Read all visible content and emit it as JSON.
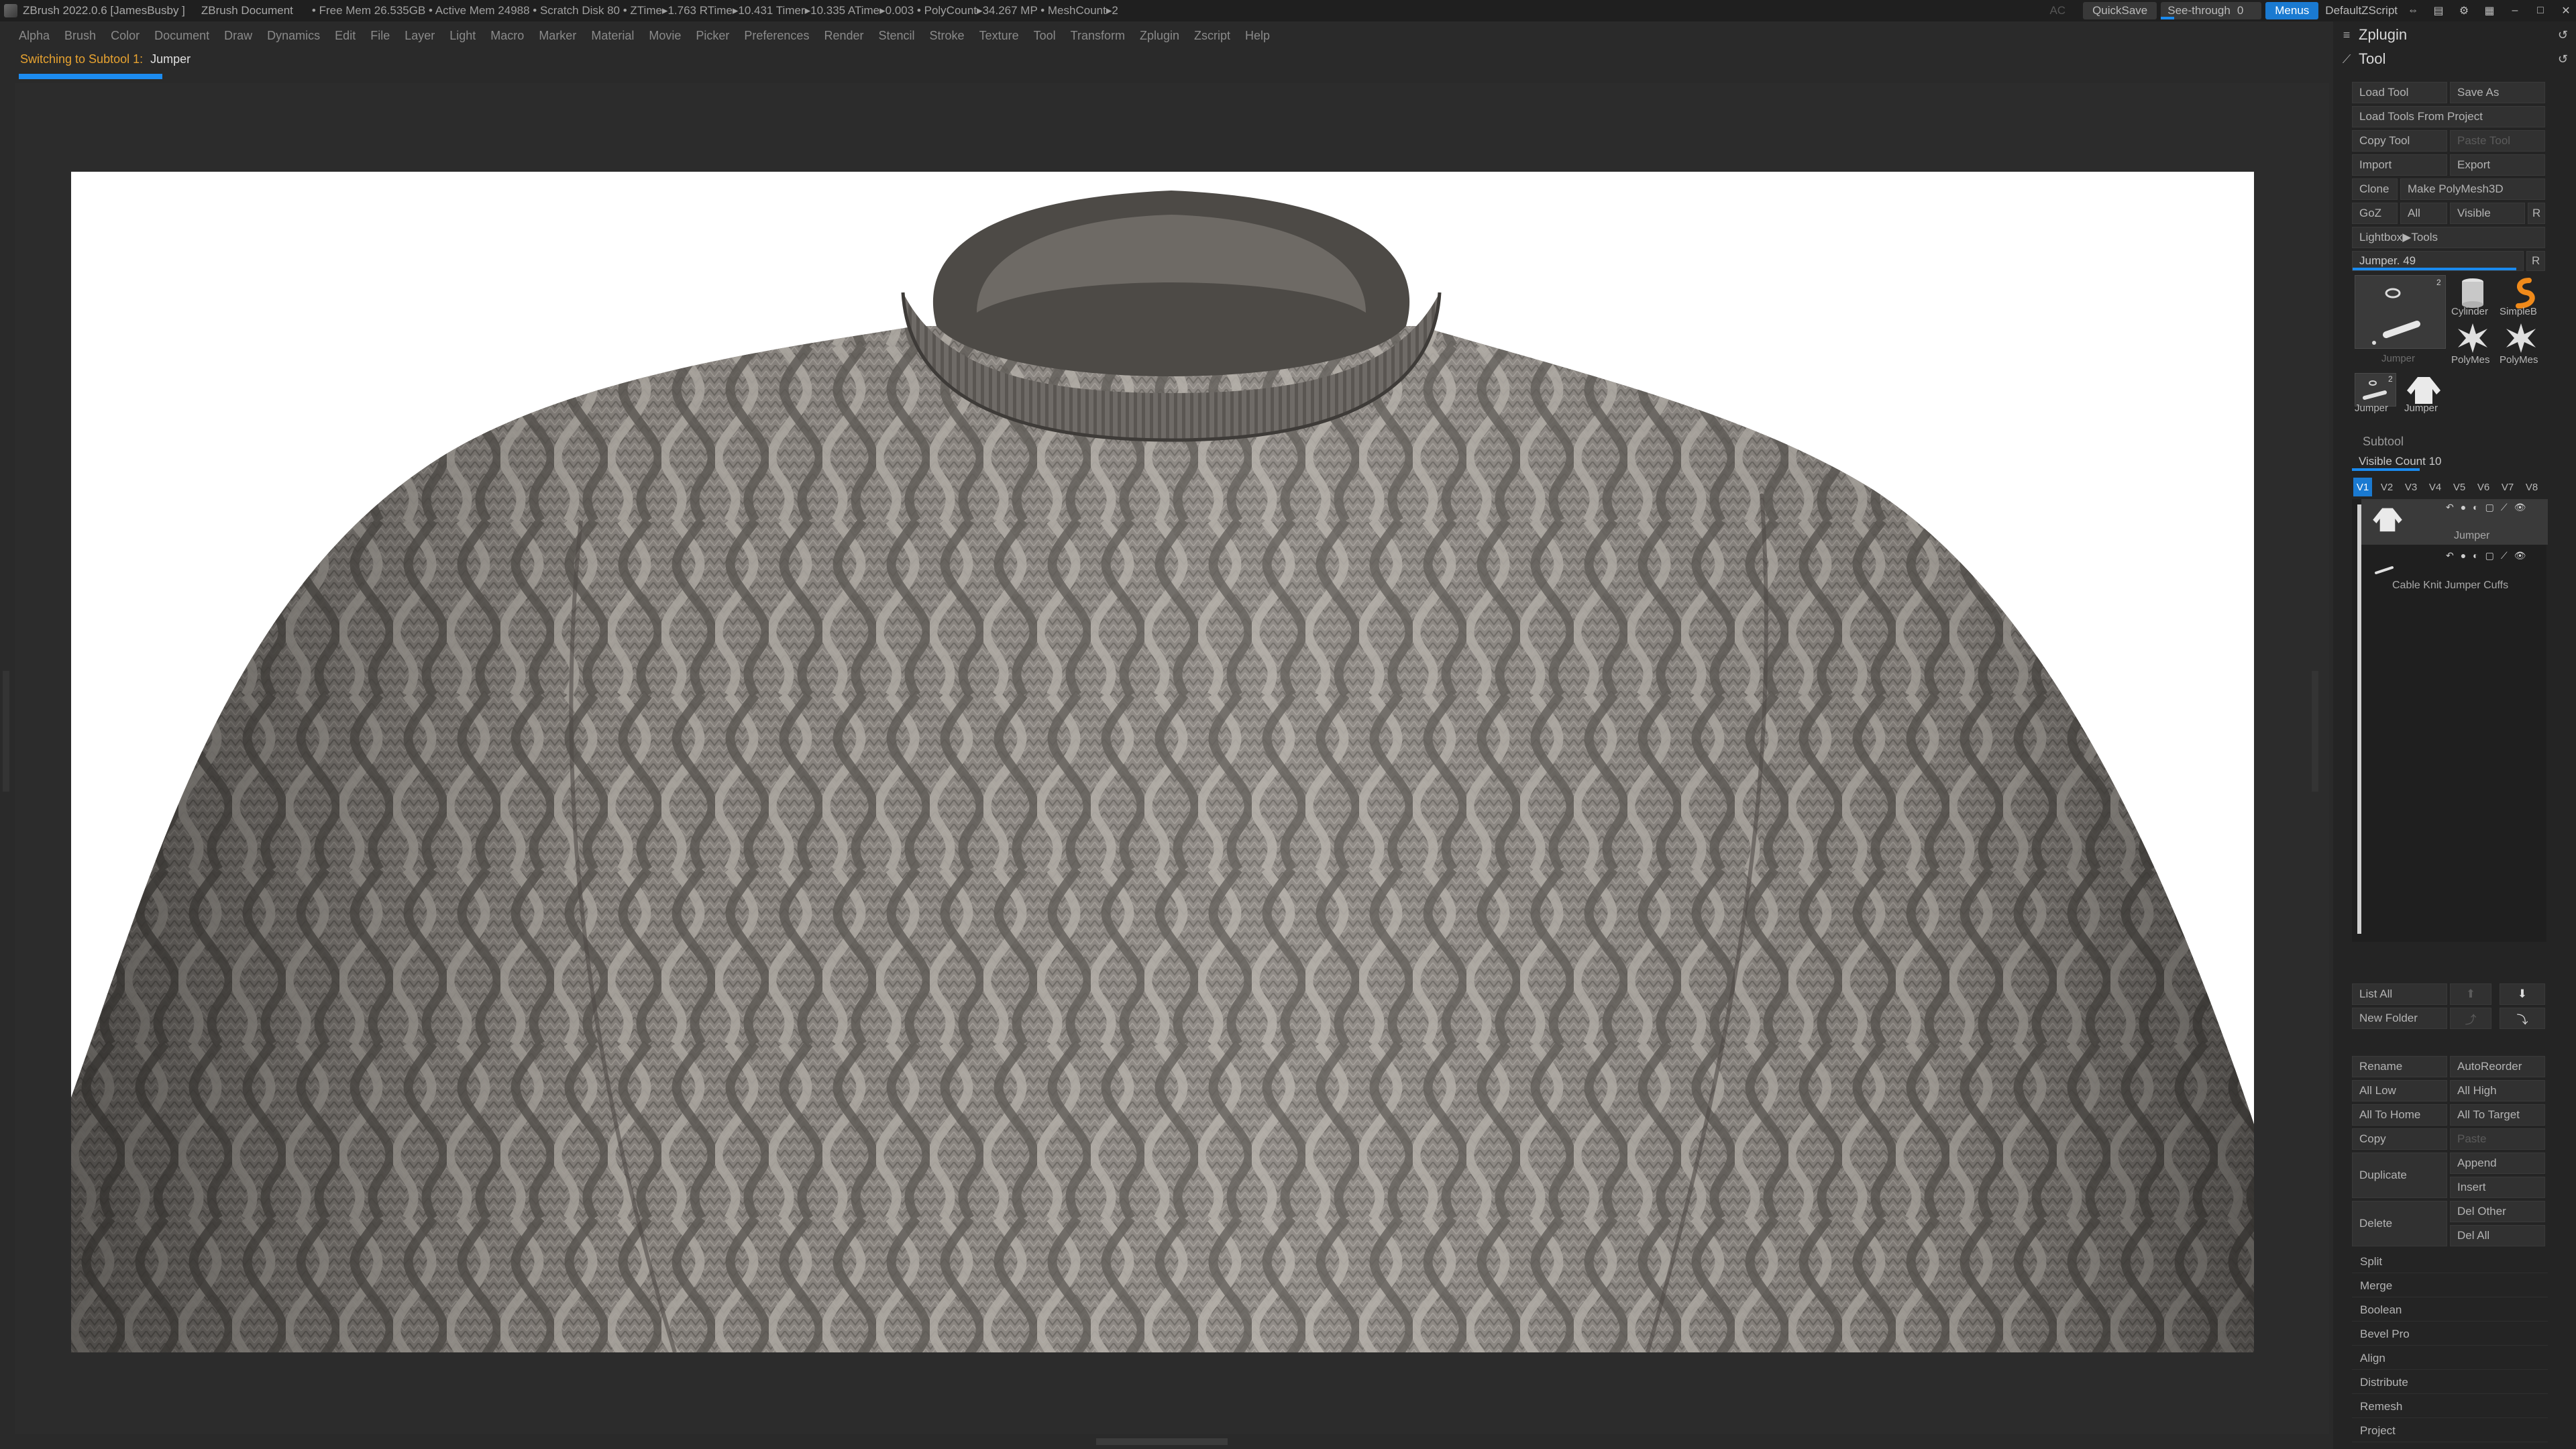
{
  "titlebar": {
    "title": "ZBrush 2022.0.6 [JamesBusby ]",
    "document": "ZBrush Document",
    "stats": "• Free Mem 26.535GB • Active Mem 24988 • Scratch Disk 80 •  ZTime▸1.763 RTime▸10.431 Timer▸10.335 ATime▸0.003 • PolyCount▸34.267 MP  • MeshCount▸2",
    "ac": "AC",
    "quicksave": "QuickSave",
    "see_through_label": "See-through",
    "see_through_value": "0",
    "see_through_level": 0.13,
    "menus": "Menus",
    "zscript": "DefaultZScript"
  },
  "menubar": [
    "Alpha",
    "Brush",
    "Color",
    "Document",
    "Draw",
    "Dynamics",
    "Edit",
    "File",
    "Layer",
    "Light",
    "Macro",
    "Marker",
    "Material",
    "Movie",
    "Picker",
    "Preferences",
    "Render",
    "Stencil",
    "Stroke",
    "Texture",
    "Tool",
    "Transform",
    "Zplugin",
    "Zscript",
    "Help"
  ],
  "notification": {
    "label": "Switching to Subtool 1:",
    "value": "Jumper",
    "progress": 1.0
  },
  "tray": {
    "zplugin": "Zplugin",
    "tool": "Tool",
    "buttons": {
      "load_tool": "Load Tool",
      "save_as": "Save As",
      "load_from_project": "Load Tools From Project",
      "copy_tool": "Copy Tool",
      "paste_tool": "Paste Tool",
      "import": "Import",
      "export": "Export",
      "clone": "Clone",
      "make_polymesh": "Make PolyMesh3D",
      "goz": "GoZ",
      "all": "All",
      "visible": "Visible",
      "r": "R",
      "lightbox_tools": "Lightbox▶Tools"
    },
    "tool_slider": {
      "label": "Jumper. 49",
      "level": 0.96,
      "r": "R"
    },
    "thumbnails": [
      {
        "label": "Jumper",
        "count": "2",
        "icon": "jumper-main-thumbnail-icon"
      },
      {
        "label": "Cylinder",
        "icon": "cylinder-icon"
      },
      {
        "label": "SimpleB",
        "icon": "simple-brush-icon"
      },
      {
        "label": "PolyMes",
        "icon": "polymesh-star-icon"
      },
      {
        "label": "PolyMes",
        "icon": "polymesh-star-icon"
      },
      {
        "label": "Jumper",
        "count": "2",
        "icon": "jumper-small-thumbnail-icon"
      },
      {
        "label": "Jumper",
        "icon": "jumper-garment-icon"
      }
    ],
    "subtool": {
      "title": "Subtool",
      "visible_count_label": "Visible Count 10",
      "visible_count_level": 0.35,
      "version_tabs": [
        "V1",
        "V2",
        "V3",
        "V4",
        "V5",
        "V6",
        "V7",
        "V8"
      ],
      "active_tab": "V1",
      "items": [
        {
          "name": "Jumper",
          "selected": true
        },
        {
          "name": "Cable Knit Jumper Cuffs",
          "selected": false
        }
      ],
      "list_all": "List All",
      "new_folder": "New Folder",
      "rename": "Rename",
      "autoreorder": "AutoReorder",
      "all_low": "All Low",
      "all_high": "All High",
      "all_to_home": "All To Home",
      "all_to_target": "All To Target",
      "copy": "Copy",
      "paste": "Paste",
      "duplicate": "Duplicate",
      "append": "Append",
      "insert": "Insert",
      "delete": "Delete",
      "del_other": "Del Other",
      "del_all": "Del All"
    },
    "subpalettes": [
      "Split",
      "Merge",
      "Boolean",
      "Bevel Pro",
      "Align",
      "Distribute",
      "Remesh",
      "Project"
    ]
  }
}
